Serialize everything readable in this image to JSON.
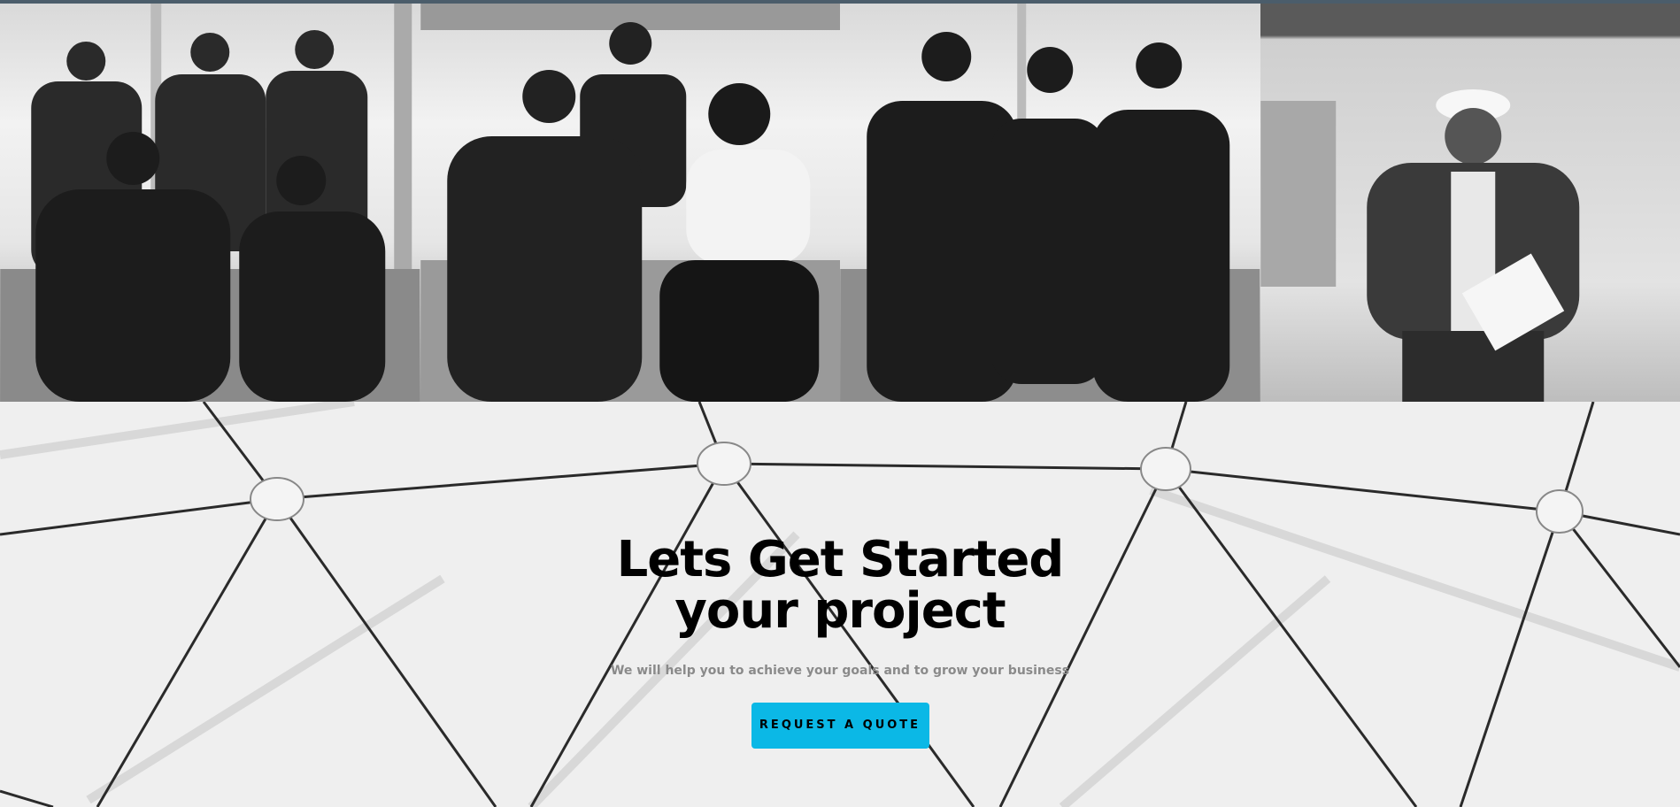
{
  "team_photos": [
    {
      "icon": "team-photo-1"
    },
    {
      "icon": "team-photo-2"
    },
    {
      "icon": "team-photo-3"
    },
    {
      "icon": "team-photo-4"
    }
  ],
  "cta": {
    "title_line1": "Lets Get Started",
    "title_line2": "your project",
    "subtitle": "We will help you to achieve your goals and to grow your business",
    "button_label": "REQUEST A QUOTE",
    "button_color": "#0bb8e6"
  }
}
